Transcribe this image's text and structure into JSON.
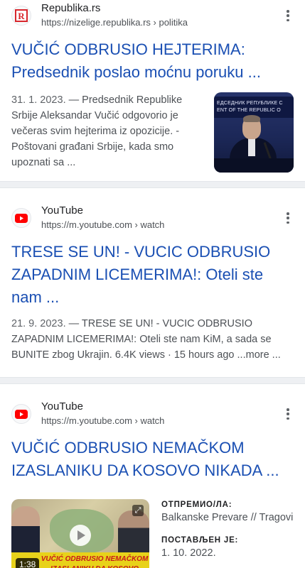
{
  "results": [
    {
      "site_name": "Republika.rs",
      "url": "https://nizelige.republika.rs › politika",
      "title": "VUČIĆ ODBRUSIO HEJTERIMA: Predsednik poslao moćnu poruku ...",
      "date": "31. 1. 2023.",
      "snippet": "— Predsednik Republike Srbije Aleksandar Vučić odgovorio je večeras svim hejterima iz opozicije. - Poštovani građani Srbije, kada smo upoznati sa ...",
      "favicon_icon": "republika-logo-icon",
      "thumb_banner": "ЕДСЕДНИК РЕПУБЛИКЕ С ENT OF THE REPUBLIC O"
    },
    {
      "site_name": "YouTube",
      "url": "https://m.youtube.com › watch",
      "title": "TRESE SE UN! - VUCIC ODBRUSIO ZAPADNIM LICEMERIMA!: Oteli ste nam ...",
      "date": "21. 9. 2023.",
      "snippet": "— TRESE SE UN! - VUCIC ODBRUSIO ZAPADNIM LICEMERIMA!: Oteli ste nam KiM, a sada se BUNITE zbog Ukrajin. 6.4K views · 15 hours ago ...more ...",
      "favicon_icon": "youtube-logo-icon"
    },
    {
      "site_name": "YouTube",
      "url": "https://m.youtube.com › watch",
      "title": "VUČIĆ ODBRUSIO NEMAČKOM IZASLANIKU DA KOSOVO NIKADA ...",
      "favicon_icon": "youtube-logo-icon",
      "video": {
        "duration": "1:38",
        "caption": "VUČIĆ ODBRUSIO NEMAČKOM IZASLANIKU DA KOSOVO NIKADA..‼"
      },
      "uploaded_by_label": "ОТПРЕМИО/ЛА:",
      "uploaded_by": "Balkanske Prevare // Tragovi",
      "published_label": "ПОСТАВЉЕН ЈЕ:",
      "published": "1. 10. 2022."
    }
  ],
  "colors": {
    "link": "#1a4fb3",
    "youtube_red": "#ff0000",
    "republika_red": "#d8262c"
  }
}
